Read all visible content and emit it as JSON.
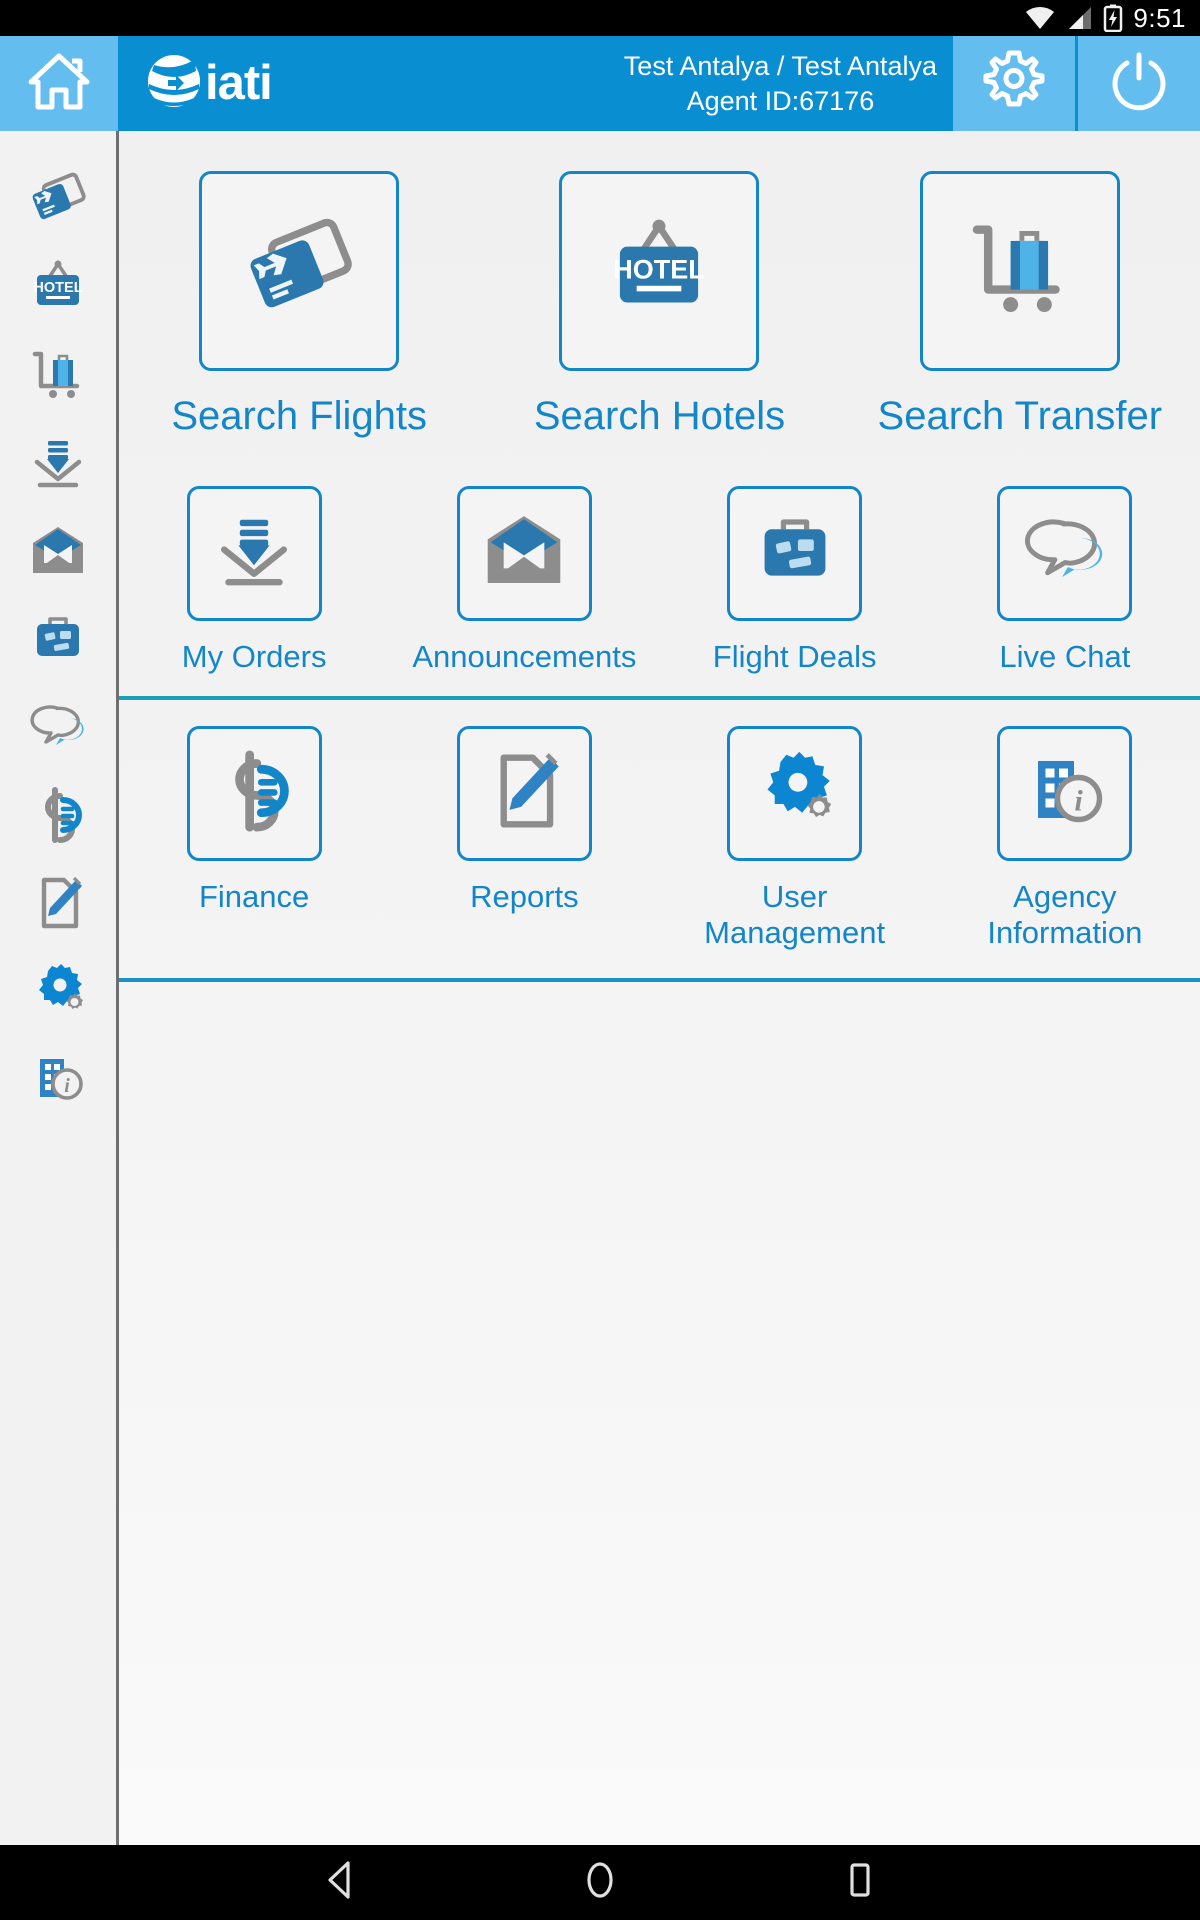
{
  "status_bar": {
    "time": "9:51",
    "icons": [
      "wifi-icon",
      "cellular-signal-icon",
      "battery-charging-icon"
    ]
  },
  "header": {
    "home_icon": "home-icon",
    "brand": "iati",
    "brand_logo_icon": "iati-globe-logo-icon",
    "agent_name": "Test Antalya / Test Antalya",
    "agent_id": "Agent ID:67176",
    "settings_icon": "gear-icon",
    "logout_icon": "power-icon",
    "bg_color": "#0a8ed2",
    "button_bg_color": "#63bdee"
  },
  "sidebar": {
    "items": [
      {
        "name": "flights",
        "icon": "flight-tickets-icon"
      },
      {
        "name": "hotels",
        "icon": "hotel-sign-icon"
      },
      {
        "name": "transfer",
        "icon": "luggage-cart-icon"
      },
      {
        "name": "orders",
        "icon": "download-orders-icon"
      },
      {
        "name": "announcements",
        "icon": "envelope-icon"
      },
      {
        "name": "flight-deals",
        "icon": "suitcase-icon"
      },
      {
        "name": "live-chat",
        "icon": "chat-bubbles-icon"
      },
      {
        "name": "finance",
        "icon": "dollar-finance-icon"
      },
      {
        "name": "reports",
        "icon": "document-pencil-icon"
      },
      {
        "name": "user-management",
        "icon": "gears-icon"
      },
      {
        "name": "agency-information",
        "icon": "building-info-icon"
      }
    ]
  },
  "main": {
    "accent_color": "#1286c9",
    "divider_color_1": "#18a0b8",
    "divider_color_2": "#1a93c4",
    "rows": [
      {
        "size": "large",
        "tiles": [
          {
            "label": "Search Flights",
            "icon": "flight-tickets-icon"
          },
          {
            "label": "Search Hotels",
            "icon": "hotel-sign-icon"
          },
          {
            "label": "Search Transfer",
            "icon": "luggage-cart-icon"
          }
        ]
      },
      {
        "size": "small",
        "tiles": [
          {
            "label": "My Orders",
            "icon": "download-orders-icon"
          },
          {
            "label": "Announcements",
            "icon": "envelope-icon"
          },
          {
            "label": "Flight Deals",
            "icon": "suitcase-icon"
          },
          {
            "label": "Live Chat",
            "icon": "chat-bubbles-icon"
          }
        ]
      },
      {
        "size": "small",
        "tiles": [
          {
            "label": "Finance",
            "icon": "dollar-finance-icon"
          },
          {
            "label": "Reports",
            "icon": "document-pencil-icon"
          },
          {
            "label": "User\nManagement",
            "icon": "gears-icon"
          },
          {
            "label": "Agency\nInformation",
            "icon": "building-info-icon"
          }
        ]
      }
    ]
  },
  "navbar": {
    "back_icon": "back-triangle-icon",
    "home_icon": "home-circle-icon",
    "recents_icon": "recents-square-icon"
  }
}
